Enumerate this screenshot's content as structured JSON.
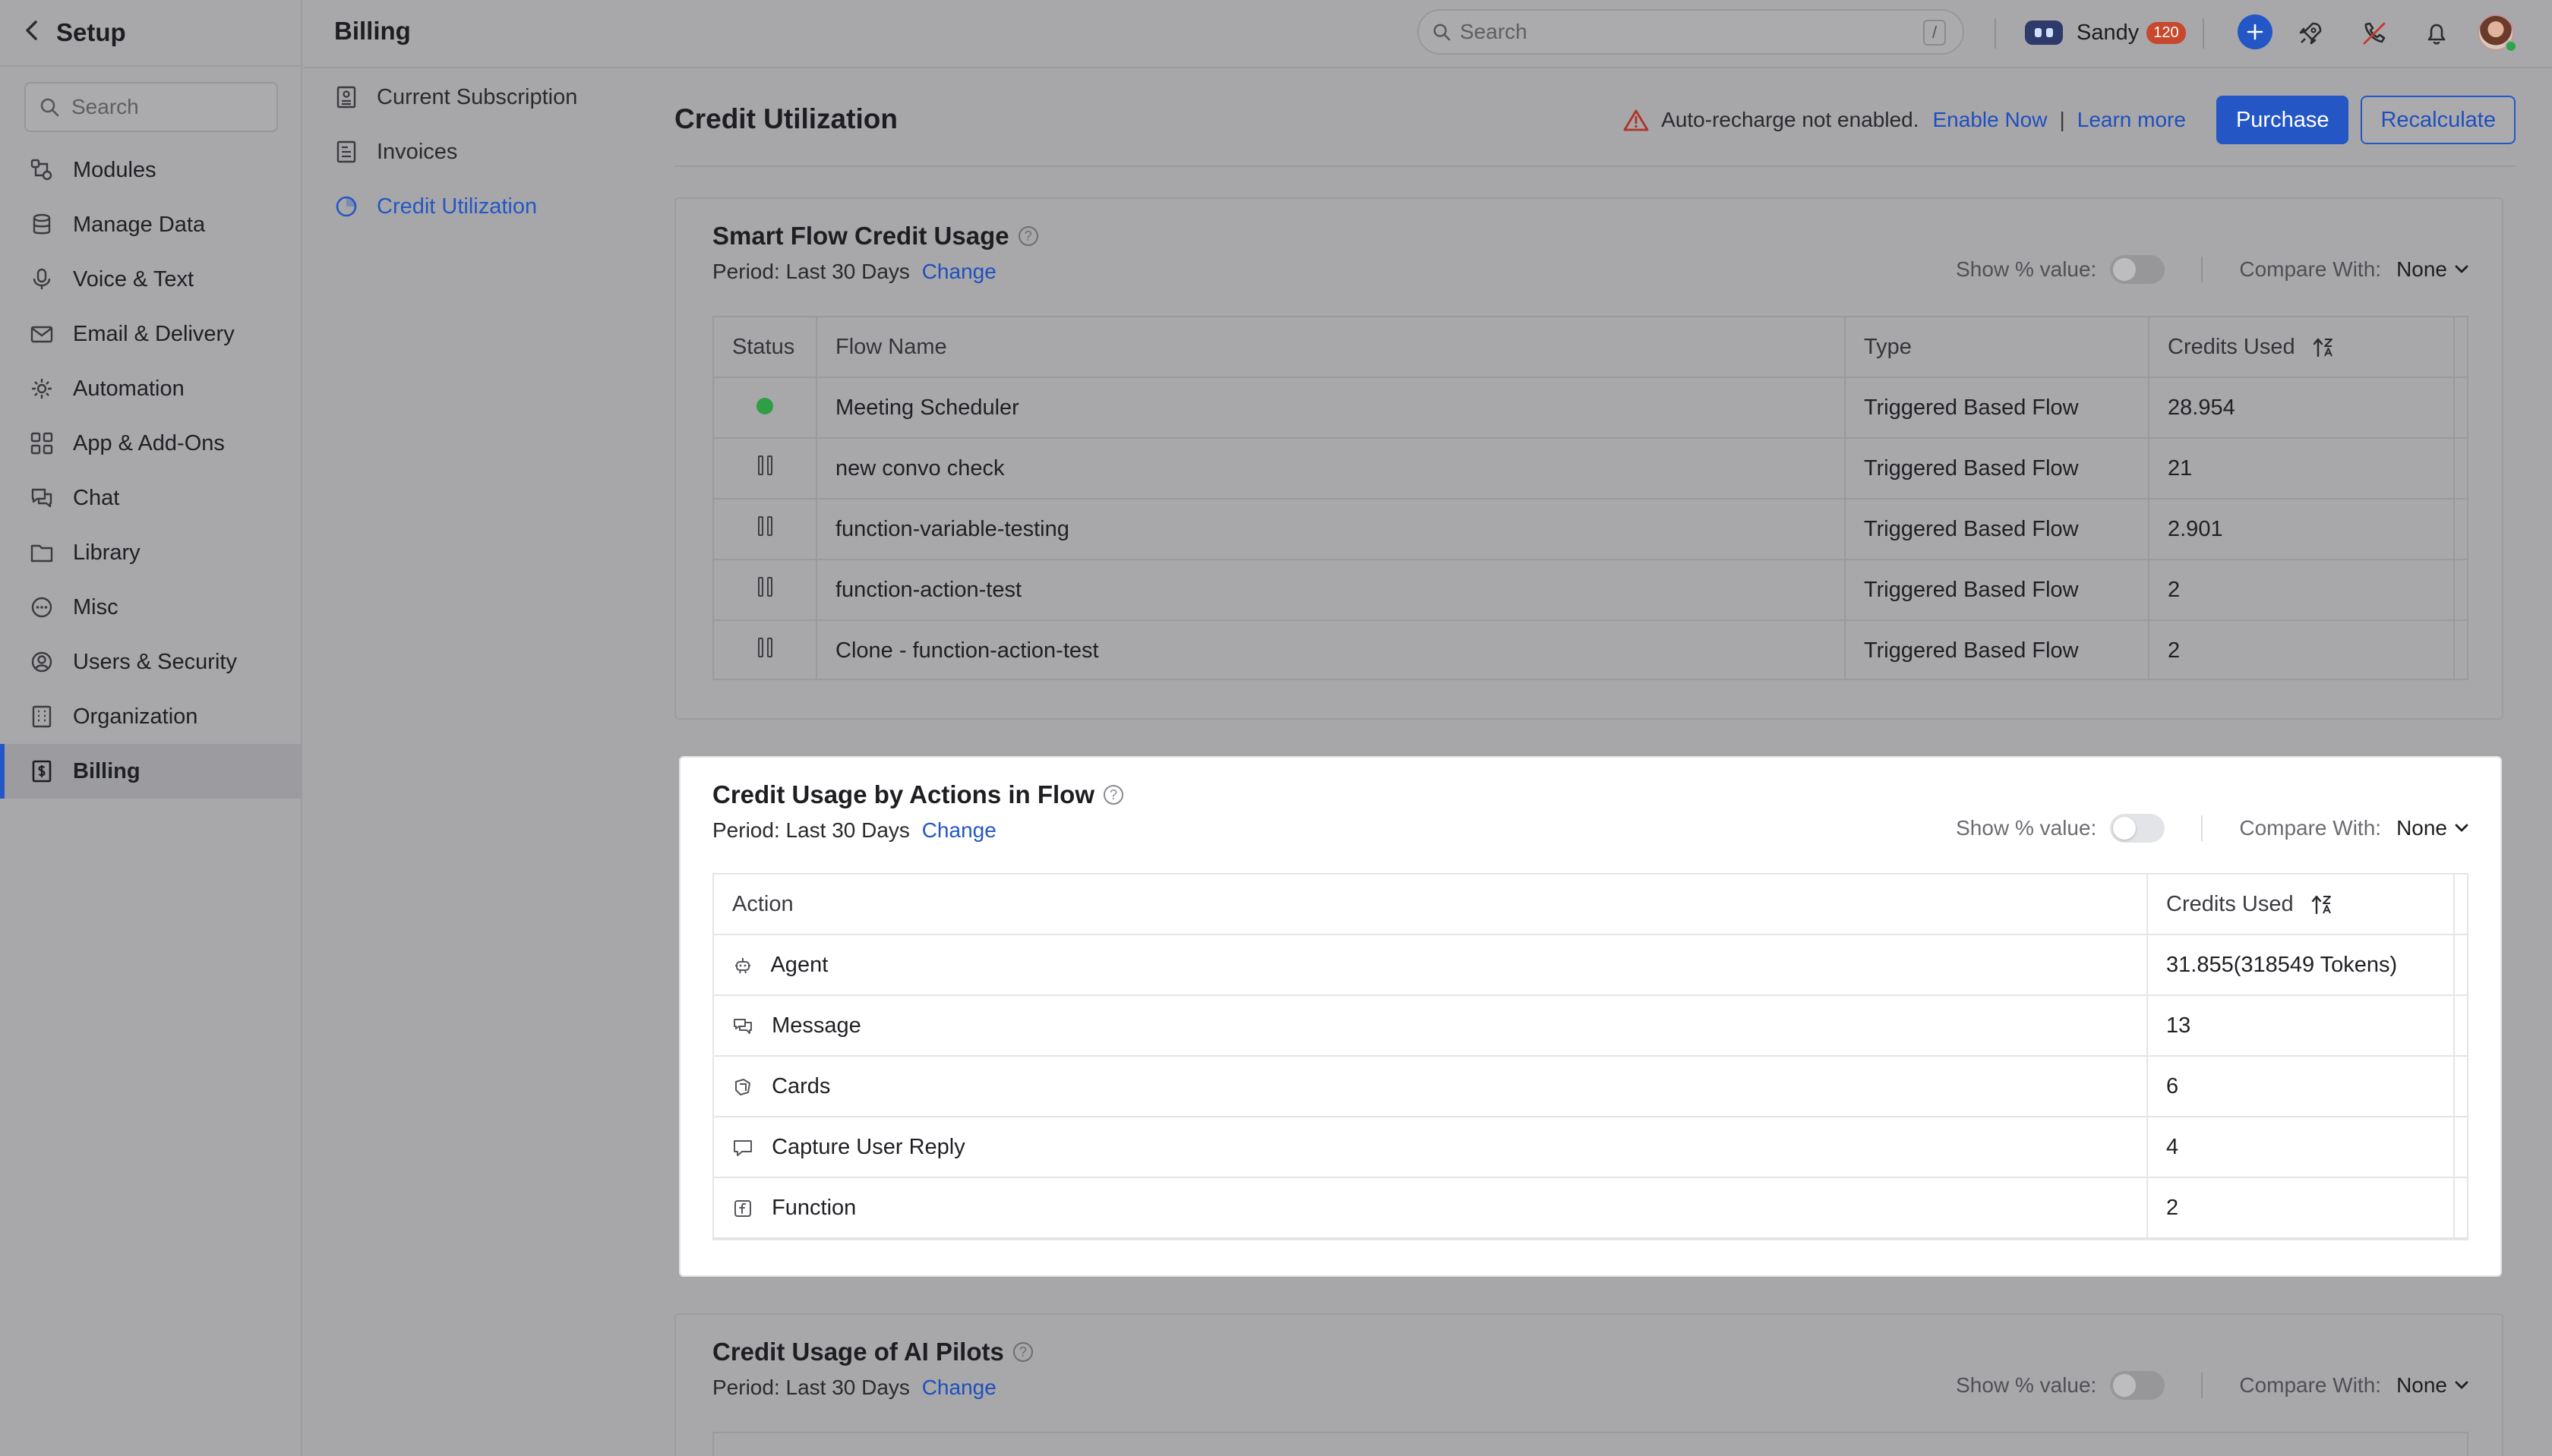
{
  "setup": {
    "title": "Setup",
    "search_placeholder": "Search",
    "nav": [
      {
        "label": "Modules",
        "icon": "modules-icon"
      },
      {
        "label": "Manage Data",
        "icon": "database-icon"
      },
      {
        "label": "Voice & Text",
        "icon": "microphone-icon"
      },
      {
        "label": "Email & Delivery",
        "icon": "mail-icon"
      },
      {
        "label": "Automation",
        "icon": "automation-icon"
      },
      {
        "label": "App & Add-Ons",
        "icon": "apps-grid-icon"
      },
      {
        "label": "Chat",
        "icon": "chat-icon"
      },
      {
        "label": "Library",
        "icon": "folder-icon"
      },
      {
        "label": "Misc",
        "icon": "more-circle-icon"
      },
      {
        "label": "Users & Security",
        "icon": "user-circle-icon"
      },
      {
        "label": "Organization",
        "icon": "building-icon"
      },
      {
        "label": "Billing",
        "icon": "billing-icon",
        "active": true
      }
    ]
  },
  "topbar": {
    "page_title": "Billing",
    "search_placeholder": "Search",
    "search_shortcut": "/",
    "user_name": "Sandy",
    "user_badge": "120"
  },
  "billing_nav": [
    {
      "label": "Current Subscription",
      "icon": "subscription-icon"
    },
    {
      "label": "Invoices",
      "icon": "invoice-icon"
    },
    {
      "label": "Credit Utilization",
      "icon": "credit-utilization-icon",
      "active": true
    }
  ],
  "main": {
    "title": "Credit Utilization",
    "warning_text": "Auto-recharge not enabled.",
    "enable_now": "Enable Now",
    "separator": "|",
    "learn_more": "Learn more",
    "purchase": "Purchase",
    "recalculate": "Recalculate"
  },
  "common": {
    "period_label": "Period: Last 30 Days",
    "change": "Change",
    "show_percent": "Show % value:",
    "compare_with": "Compare With:",
    "compare_value": "None"
  },
  "smart_flow": {
    "title": "Smart Flow Credit Usage",
    "columns": [
      "Status",
      "Flow Name",
      "Type",
      "Credits Used"
    ],
    "rows": [
      {
        "status": "active",
        "name": "Meeting Scheduler",
        "type": "Triggered Based Flow",
        "credits": "28.954"
      },
      {
        "status": "paused",
        "name": "new convo check",
        "type": "Triggered Based Flow",
        "credits": "21"
      },
      {
        "status": "paused",
        "name": "function-variable-testing",
        "type": "Triggered Based Flow",
        "credits": "2.901"
      },
      {
        "status": "paused",
        "name": "function-action-test",
        "type": "Triggered Based Flow",
        "credits": "2"
      },
      {
        "status": "paused",
        "name": "Clone - function-action-test",
        "type": "Triggered Based Flow",
        "credits": "2"
      }
    ]
  },
  "actions_in_flow": {
    "title": "Credit Usage by Actions in Flow",
    "columns": [
      "Action",
      "Credits Used"
    ],
    "rows": [
      {
        "icon": "agent-icon",
        "action": "Agent",
        "credits": "31.855(318549 Tokens)"
      },
      {
        "icon": "message-icon",
        "action": "Message",
        "credits": "13"
      },
      {
        "icon": "cards-icon",
        "action": "Cards",
        "credits": "6"
      },
      {
        "icon": "capture-reply-icon",
        "action": "Capture User Reply",
        "credits": "4"
      },
      {
        "icon": "function-icon",
        "action": "Function",
        "credits": "2"
      }
    ]
  },
  "ai_pilots": {
    "title": "Credit Usage of AI Pilots"
  },
  "colors": {
    "accent": "#2457c5",
    "overlay_bg": "#a8a8aa",
    "focus_card_bg": "#ffffff",
    "active_status": "#2f9e44",
    "badge": "#c7482d"
  }
}
